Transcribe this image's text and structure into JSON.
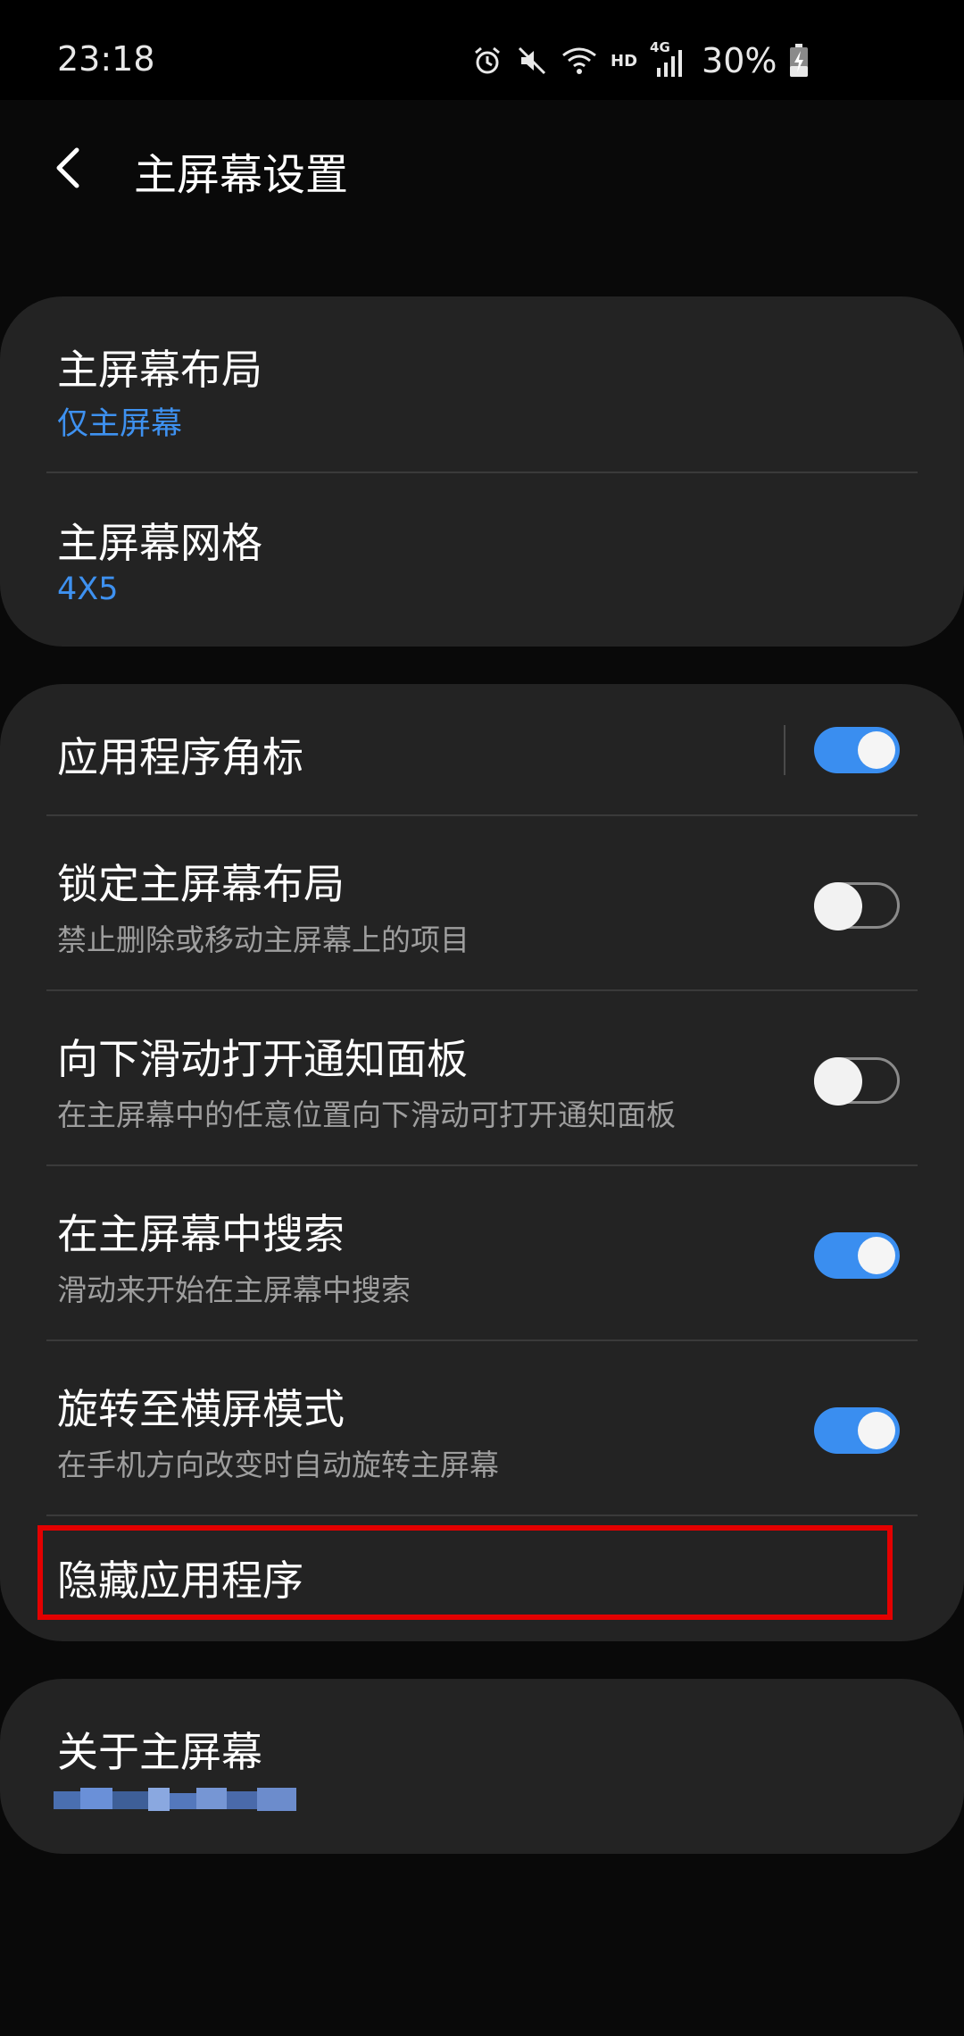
{
  "status": {
    "time": "23:18",
    "hd": "HD",
    "net": "4G",
    "battery": "30%"
  },
  "header": {
    "title": "主屏幕设置"
  },
  "group1": [
    {
      "title": "主屏幕布局",
      "sub": "仅主屏幕"
    },
    {
      "title": "主屏幕网格",
      "sub": "4X5"
    }
  ],
  "group2": [
    {
      "title": "应用程序角标",
      "toggle": "on"
    },
    {
      "title": "锁定主屏幕布局",
      "sub": "禁止删除或移动主屏幕上的项目",
      "toggle": "off"
    },
    {
      "title": "向下滑动打开通知面板",
      "sub": "在主屏幕中的任意位置向下滑动可打开通知面板",
      "toggle": "off"
    },
    {
      "title": "在主屏幕中搜索",
      "sub": "滑动来开始在主屏幕中搜索",
      "toggle": "on"
    },
    {
      "title": "旋转至横屏模式",
      "sub": "在手机方向改变时自动旋转主屏幕",
      "toggle": "on"
    },
    {
      "title": "隐藏应用程序"
    }
  ],
  "group3": [
    {
      "title": "关于主屏幕"
    }
  ],
  "colors": {
    "accent": "#3e91f0",
    "card": "#232323",
    "background": "#090909",
    "highlight": "#e30000"
  }
}
